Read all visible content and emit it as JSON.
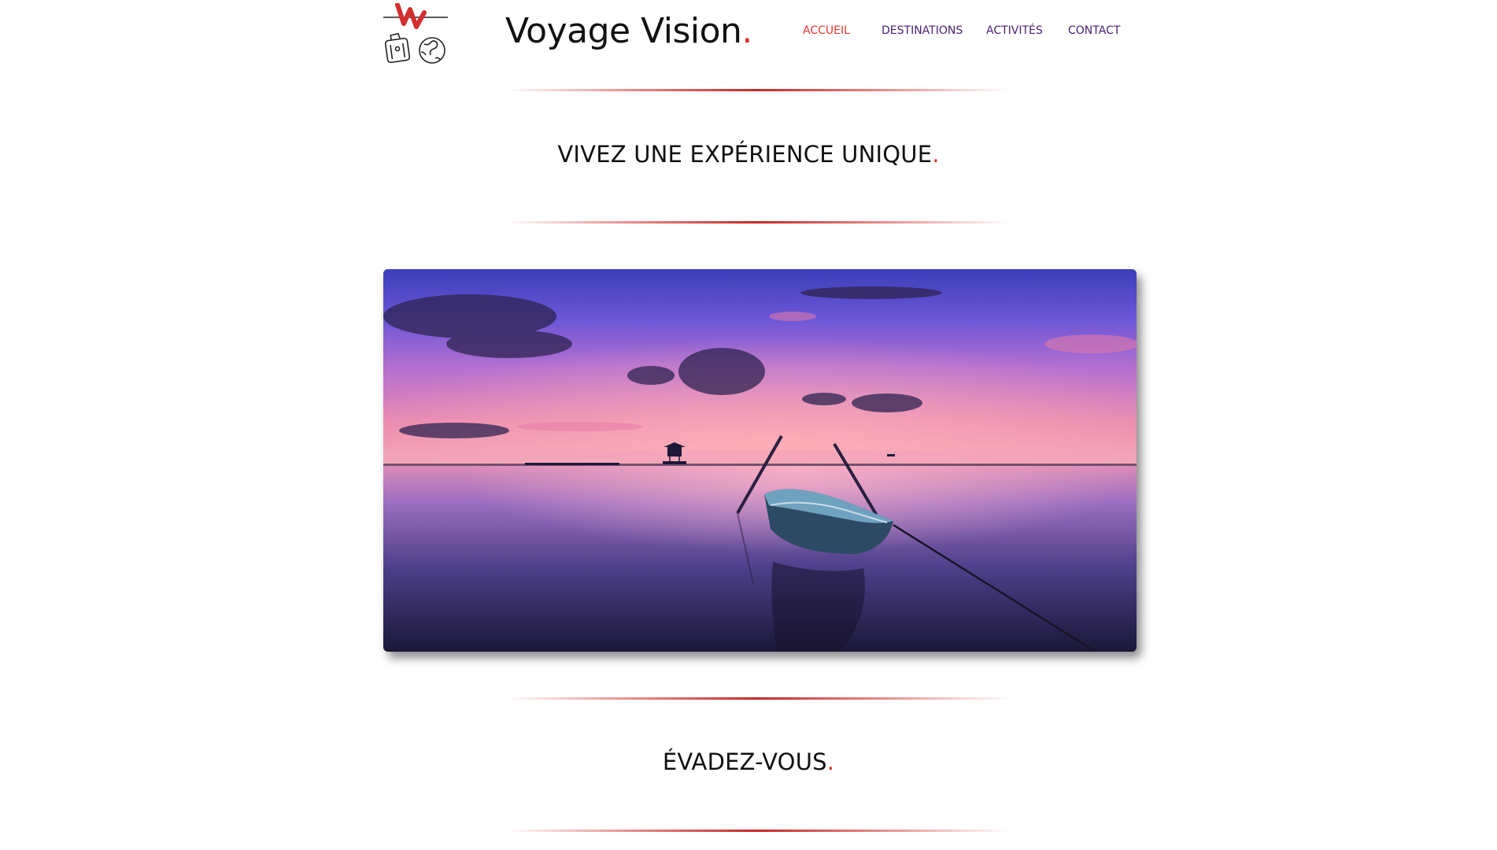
{
  "header": {
    "logo_icon": "voyage-vision-logo-icon",
    "site_title": "Voyage Vision",
    "site_title_dot": "."
  },
  "nav": {
    "items": [
      {
        "label": "ACCUEIL",
        "active": true
      },
      {
        "label": "DESTINATIONS",
        "active": false
      },
      {
        "label": "ACTIVITÉS",
        "active": false
      },
      {
        "label": "CONTACT",
        "active": false
      }
    ]
  },
  "sections": {
    "hero_heading": "VIVEZ UNE EXPÉRIENCE UNIQUE",
    "hero_heading_dot": ".",
    "second_heading": "ÉVADEZ-VOUS",
    "second_heading_dot": "."
  },
  "colors": {
    "accent": "#d32f2f",
    "nav_text": "#4a1f6e",
    "nav_active": "#e53935",
    "heading_text": "#111111"
  }
}
